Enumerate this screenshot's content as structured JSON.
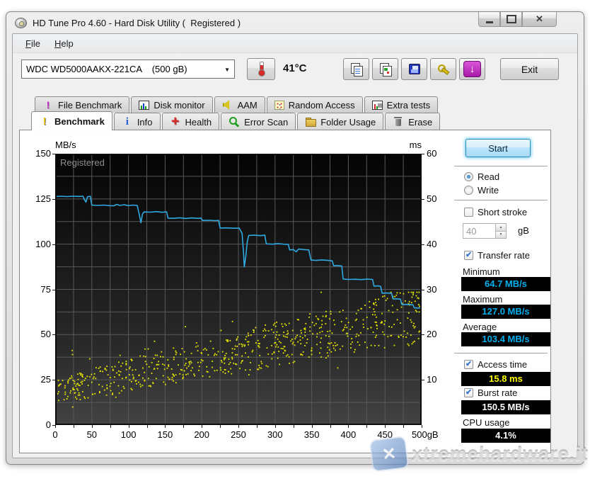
{
  "window": {
    "title": "HD Tune Pro 4.60 - Hard Disk Utility (  Registered )",
    "buttons": [
      "minimize",
      "maximize",
      "close"
    ]
  },
  "menu": {
    "items": [
      {
        "label": "File"
      },
      {
        "label": "Help"
      }
    ]
  },
  "toolbar": {
    "device_combo": {
      "value": "WDC WD5000AAKX-221CA    (500 gB)"
    },
    "temperature": "41°C",
    "buttons": [
      {
        "name": "copy-text-button",
        "icon": "copy-text-icon"
      },
      {
        "name": "copy-image-button",
        "icon": "copy-image-icon"
      },
      {
        "name": "save-button",
        "icon": "save-icon"
      },
      {
        "name": "register-keys-button",
        "icon": "keys-icon"
      },
      {
        "name": "update-button",
        "icon": "update-icon"
      }
    ],
    "exit_label": "Exit"
  },
  "tabs": {
    "back_row": [
      {
        "name": "file-benchmark",
        "label": "File Benchmark",
        "icon": "file-benchmark-icon"
      },
      {
        "name": "disk-monitor",
        "label": "Disk monitor",
        "icon": "disk-monitor-icon"
      },
      {
        "name": "aam",
        "label": "AAM",
        "icon": "aam-icon"
      },
      {
        "name": "random-access",
        "label": "Random Access",
        "icon": "random-access-icon"
      },
      {
        "name": "extra-tests",
        "label": "Extra tests",
        "icon": "extra-tests-icon"
      }
    ],
    "front_row": [
      {
        "name": "benchmark",
        "label": "Benchmark",
        "icon": "benchmark-icon",
        "active": true
      },
      {
        "name": "info",
        "label": "Info",
        "icon": "info-icon"
      },
      {
        "name": "health",
        "label": "Health",
        "icon": "health-icon"
      },
      {
        "name": "error-scan",
        "label": "Error Scan",
        "icon": "error-scan-icon"
      },
      {
        "name": "folder-usage",
        "label": "Folder Usage",
        "icon": "folder-icon"
      },
      {
        "name": "erase",
        "label": "Erase",
        "icon": "erase-icon"
      }
    ]
  },
  "controls": {
    "start_label": "Start",
    "read": {
      "label": "Read",
      "selected": true
    },
    "write": {
      "label": "Write",
      "selected": false
    },
    "short_stroke": {
      "label": "Short stroke",
      "checked": false,
      "capacity_value": "40",
      "capacity_unit": "gB"
    },
    "transfer_rate": {
      "label": "Transfer rate",
      "checked": true
    }
  },
  "results": {
    "minimum": {
      "label": "Minimum",
      "value": "64.7 MB/s",
      "color": "#00b0f0"
    },
    "maximum": {
      "label": "Maximum",
      "value": "127.0 MB/s",
      "color": "#00b0f0"
    },
    "average": {
      "label": "Average",
      "value": "103.4 MB/s",
      "color": "#00b0f0"
    },
    "access_time": {
      "label": "Access time",
      "value": "15.8 ms",
      "color": "#ffff00",
      "checked": true
    },
    "burst_rate": {
      "label": "Burst rate",
      "value": "150.5 MB/s",
      "color": "#ffffff",
      "checked": true
    },
    "cpu_usage": {
      "label": "CPU usage",
      "value": "4.1%",
      "color": "#ffffff"
    }
  },
  "chart_data": {
    "type": "line",
    "overlay_text": "Registered",
    "grid_color": "#585858",
    "bg_top": "#040404",
    "bg_bottom": "#434343",
    "x_axis": {
      "min": 0,
      "max": 500,
      "minor_step": 25,
      "labels": [
        "0",
        "50",
        "100",
        "150",
        "200",
        "250",
        "300",
        "350",
        "400",
        "450",
        "500gB"
      ]
    },
    "y_left": {
      "axis_label": "MB/s",
      "min": 0,
      "max": 150,
      "step": 25,
      "minor_step": 12.5,
      "labels": [
        "150",
        "125",
        "100",
        "75",
        "50",
        "25",
        "0"
      ]
    },
    "y_right": {
      "axis_label": "ms",
      "min": 0,
      "max": 60,
      "step": 10,
      "labels": [
        "60",
        "50",
        "40",
        "30",
        "20",
        "10"
      ]
    },
    "series": [
      {
        "name": "transfer-rate",
        "type": "line",
        "axis": "left",
        "color": "#2fa9e0",
        "points": [
          [
            0,
            126.3
          ],
          [
            8,
            126.5
          ],
          [
            16,
            126.3
          ],
          [
            24,
            126.5
          ],
          [
            32,
            126.4
          ],
          [
            38,
            126.5
          ],
          [
            40,
            124.6
          ],
          [
            42,
            123.2
          ],
          [
            44,
            126.2
          ],
          [
            48,
            126.5
          ],
          [
            50,
            121.6
          ],
          [
            58,
            121.4
          ],
          [
            66,
            121.6
          ],
          [
            74,
            121.3
          ],
          [
            80,
            121.2
          ],
          [
            84,
            122
          ],
          [
            88,
            121.4
          ],
          [
            94,
            121.8
          ],
          [
            100,
            121.3
          ],
          [
            106,
            121.6
          ],
          [
            112,
            121.4
          ],
          [
            115,
            116
          ],
          [
            117,
            111.8
          ],
          [
            119,
            116.5
          ],
          [
            121,
            117.8
          ],
          [
            130,
            117.7
          ],
          [
            138,
            118
          ],
          [
            146,
            117.6
          ],
          [
            152,
            117.9
          ],
          [
            154,
            114.4
          ],
          [
            162,
            114.3
          ],
          [
            170,
            114.6
          ],
          [
            178,
            114.2
          ],
          [
            186,
            114.5
          ],
          [
            194,
            114.3
          ],
          [
            199,
            114.4
          ],
          [
            201,
            113.1
          ],
          [
            210,
            113.2
          ],
          [
            218,
            113
          ],
          [
            223,
            113.1
          ],
          [
            225,
            108.9
          ],
          [
            234,
            109
          ],
          [
            243,
            108.8
          ],
          [
            251,
            108.9
          ],
          [
            255,
            106
          ],
          [
            257,
            95
          ],
          [
            258,
            87.4
          ],
          [
            260,
            93
          ],
          [
            262,
            101
          ],
          [
            264,
            104.8
          ],
          [
            272,
            105
          ],
          [
            280,
            104.7
          ],
          [
            286,
            105
          ],
          [
            288,
            100.2
          ],
          [
            296,
            100
          ],
          [
            304,
            100.3
          ],
          [
            312,
            100
          ],
          [
            318,
            99.9
          ],
          [
            320,
            96.8
          ],
          [
            325,
            97
          ],
          [
            329,
            95.8
          ],
          [
            332,
            97.3
          ],
          [
            339,
            97
          ],
          [
            346,
            96.8
          ],
          [
            349,
            91.2
          ],
          [
            356,
            91
          ],
          [
            364,
            91.3
          ],
          [
            372,
            91
          ],
          [
            378,
            90.8
          ],
          [
            380,
            88
          ],
          [
            385,
            88.2
          ],
          [
            391,
            87.9
          ],
          [
            393,
            80.7
          ],
          [
            400,
            80.5
          ],
          [
            409,
            80.6
          ],
          [
            418,
            80.4
          ],
          [
            426,
            80.7
          ],
          [
            433,
            80.5
          ],
          [
            435,
            76.8
          ],
          [
            440,
            76.9
          ],
          [
            444,
            76.7
          ],
          [
            446,
            72.9
          ],
          [
            452,
            73
          ],
          [
            459,
            72.8
          ],
          [
            461,
            69.7
          ],
          [
            466,
            69.8
          ],
          [
            471,
            69.6
          ],
          [
            473,
            66.6
          ],
          [
            480,
            66.7
          ],
          [
            488,
            66.5
          ],
          [
            490,
            64.8
          ],
          [
            495,
            64.7
          ],
          [
            500,
            64.9
          ]
        ]
      },
      {
        "name": "access-time",
        "type": "scatter",
        "axis": "right",
        "color": "#e9e900",
        "generator": {
          "seed": 42,
          "count": 680,
          "ms_base": 7.5,
          "ms_slope": 17,
          "spread": 4.2,
          "outlier_rate": 0.08,
          "outlier_extra": 6,
          "min_ms": 2.5,
          "max_ms": 29.5
        }
      }
    ]
  },
  "watermark": {
    "text": "xtremehardware.it",
    "logo_glyph": "✕"
  }
}
